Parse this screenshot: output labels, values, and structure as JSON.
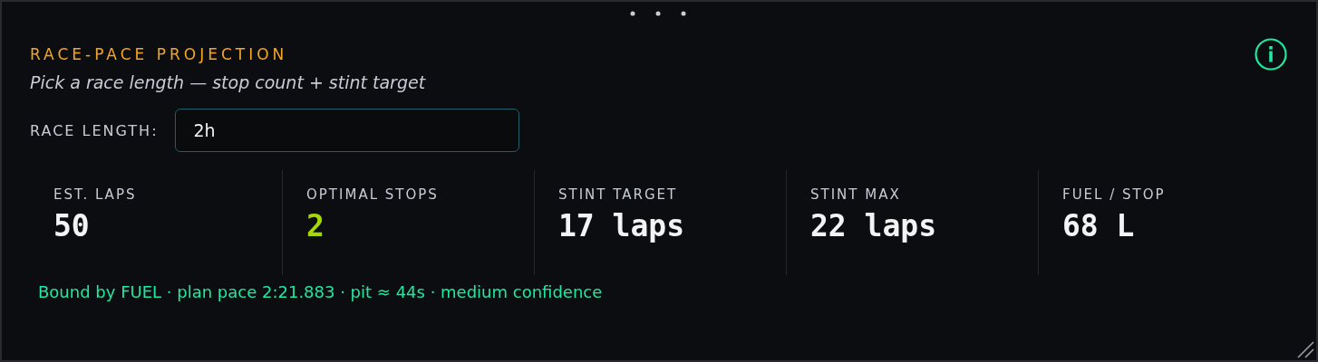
{
  "title": "RACE-PACE PROJECTION",
  "subtitle": "Pick a race length — stop count + stint target",
  "race_length": {
    "label": "RACE LENGTH:",
    "value": "2h"
  },
  "stats": [
    {
      "label": "EST. LAPS",
      "value": "50",
      "color": "#f2f3f5"
    },
    {
      "label": "OPTIMAL STOPS",
      "value": "2",
      "color": "#a6d60a"
    },
    {
      "label": "STINT TARGET",
      "value": "17 laps",
      "color": "#f2f3f5"
    },
    {
      "label": "STINT MAX",
      "value": "22 laps",
      "color": "#f2f3f5"
    },
    {
      "label": "FUEL / STOP",
      "value": "68 L",
      "color": "#f2f3f5"
    }
  ],
  "summary": "Bound by FUEL · plan pace 2:21.883 · pit ≈ 44s · medium confidence"
}
